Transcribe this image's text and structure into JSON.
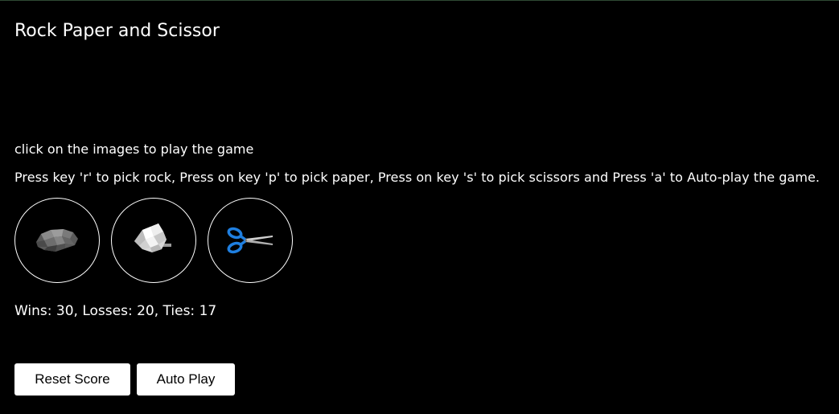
{
  "title": "Rock Paper and Scissor",
  "instructions": {
    "line1": "click on the images to play the game",
    "line2": "Press key 'r' to pick rock, Press on key 'p' to pick paper, Press on key 's' to pick scissors and Press 'a' to Auto-play the game."
  },
  "choices": [
    {
      "name": "rock",
      "icon": "rock-icon"
    },
    {
      "name": "paper",
      "icon": "paper-icon"
    },
    {
      "name": "scissors",
      "icon": "scissors-icon"
    }
  ],
  "score": {
    "text": "Wins: 30, Losses: 20, Ties: 17",
    "wins": 30,
    "losses": 20,
    "ties": 17
  },
  "buttons": {
    "reset_label": "Reset Score",
    "auto_label": "Auto Play"
  },
  "colors": {
    "background": "#000000",
    "text": "#ffffff",
    "scissors_handle": "#1f7fe0"
  }
}
